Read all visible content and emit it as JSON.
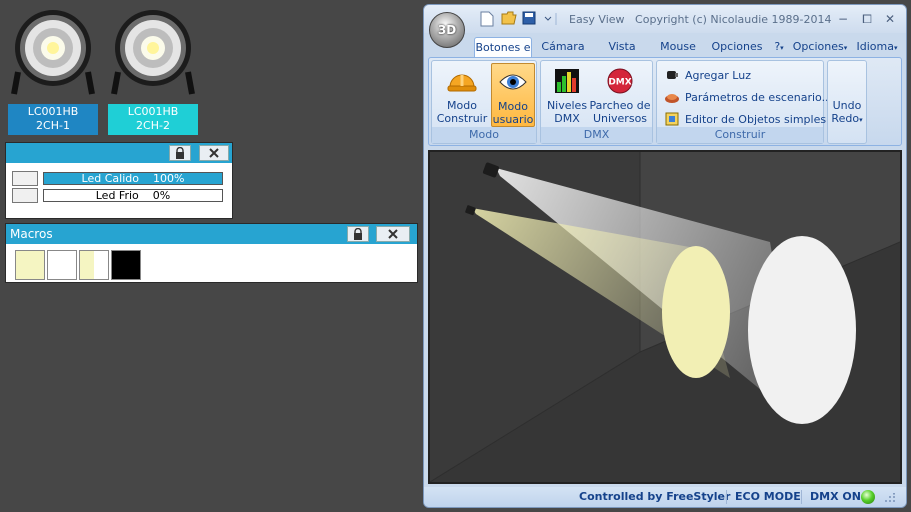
{
  "fixtures": [
    {
      "line1": "LC001HB",
      "line2": "2CH-1",
      "label_bg": "#1f86c3"
    },
    {
      "line1": "LC001HB",
      "line2": "2CH-2",
      "label_bg": "#1fcfd6"
    }
  ],
  "channels_panel": {
    "rows": [
      {
        "label": "Led Calido",
        "value": "100%"
      },
      {
        "label": "Led Frio",
        "value": "0%"
      }
    ]
  },
  "macros_panel": {
    "title": "Macros",
    "swatch_colors": [
      "#f5f5c2",
      "#ffffff",
      "#f5f5c2",
      "#000000"
    ]
  },
  "window": {
    "title": "Easy View",
    "copyright": "Copyright (c) Nicolaudie 1989-2014",
    "orb_label": "3D",
    "controls": {
      "minimize": "−",
      "restore": "⧠",
      "close": "✕"
    },
    "tabs": [
      "Botones e",
      "Cámara",
      "Vista",
      "Mouse",
      "Opciones"
    ],
    "right_menus": {
      "help": "?",
      "options": "Opciones",
      "language": "Idioma"
    },
    "groups": {
      "modo": {
        "caption": "Modo",
        "buttons": [
          {
            "line1": "Modo",
            "line2": "Construir",
            "icon": "hardhat-icon"
          },
          {
            "line1": "Modo",
            "line2": "usuario",
            "icon": "eye-icon"
          }
        ]
      },
      "dmx": {
        "caption": "DMX",
        "buttons": [
          {
            "line1": "Niveles",
            "line2": "DMX",
            "icon": "levels-icon"
          },
          {
            "line1": "Parcheo de",
            "line2": "Universos",
            "icon": "dmx-icon",
            "icon_text": "DMX"
          }
        ]
      },
      "construir": {
        "caption": "Construir",
        "items": [
          {
            "label": "Agregar Luz",
            "icon": "spotlight-icon"
          },
          {
            "label": "Parámetros de escenario...",
            "icon": "stage-icon"
          },
          {
            "label": "Editor de Objetos simples",
            "icon": "objects-icon"
          }
        ]
      },
      "undo": {
        "label1": "Undo",
        "label2": "Redo"
      }
    },
    "status": {
      "controlled": "Controlled by FreeStyler",
      "eco": "ECO MODE",
      "dmx": "DMX ON"
    }
  },
  "colors": {
    "accent": "#27a4d1",
    "warm_light": "#f2efb4",
    "cold_light": "#f1f1f1"
  }
}
